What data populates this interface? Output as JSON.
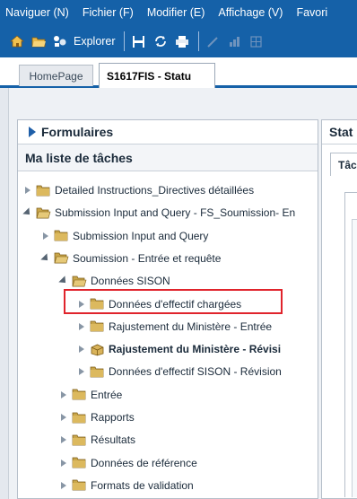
{
  "menubar": {
    "items": [
      "Naviguer (N)",
      "Fichier (F)",
      "Modifier (E)",
      "Affichage (V)",
      "Favori"
    ]
  },
  "toolbar": {
    "explorer_label": "Explorer",
    "icons": [
      "home-icon",
      "open-folder-icon",
      "explorer-icon",
      "save-icon",
      "refresh-icon",
      "print-icon",
      "edit-icon",
      "chart-icon",
      "grid-icon"
    ]
  },
  "tabs": {
    "home": "HomePage",
    "active": "S1617FIS - Statu"
  },
  "left_panel": {
    "forms_title": "Formulaires",
    "tasks_title": "Ma liste de tâches",
    "tree": [
      {
        "label": "Detailed Instructions_Directives détaillées",
        "level": 0,
        "expanded": false,
        "bold": false
      },
      {
        "label": "Submission Input and Query - FS_Soumission- En",
        "level": 0,
        "expanded": true,
        "bold": false
      },
      {
        "label": "Submission Input and Query",
        "level": 1,
        "expanded": false,
        "bold": false
      },
      {
        "label": "Soumission - Entrée et requête",
        "level": 1,
        "expanded": true,
        "bold": false
      },
      {
        "label": "Données SISON",
        "level": 2,
        "expanded": true,
        "bold": false
      },
      {
        "label": "Données d'effectif chargées",
        "level": 3,
        "expanded": false,
        "bold": false
      },
      {
        "label": "Rajustement du Ministère - Entrée",
        "level": 3,
        "expanded": false,
        "bold": false
      },
      {
        "label": "Rajustement du Ministère - Révisi",
        "level": 3,
        "expanded": false,
        "bold": true
      },
      {
        "label": "Données d'effectif SISON - Révision",
        "level": 3,
        "expanded": false,
        "bold": false
      },
      {
        "label": "Entrée",
        "level": 2,
        "expanded": false,
        "bold": false
      },
      {
        "label": "Rapports",
        "level": 2,
        "expanded": false,
        "bold": false
      },
      {
        "label": "Résultats",
        "level": 2,
        "expanded": false,
        "bold": false
      },
      {
        "label": "Données de référence",
        "level": 2,
        "expanded": false,
        "bold": false
      },
      {
        "label": "Formats de validation",
        "level": 2,
        "expanded": false,
        "bold": false
      }
    ]
  },
  "right_panel": {
    "title": "Stat",
    "tab": "Tâc"
  },
  "colors": {
    "menubar": "#1561a8",
    "folder": "#c9a64a",
    "highlight": "#e0242c"
  }
}
